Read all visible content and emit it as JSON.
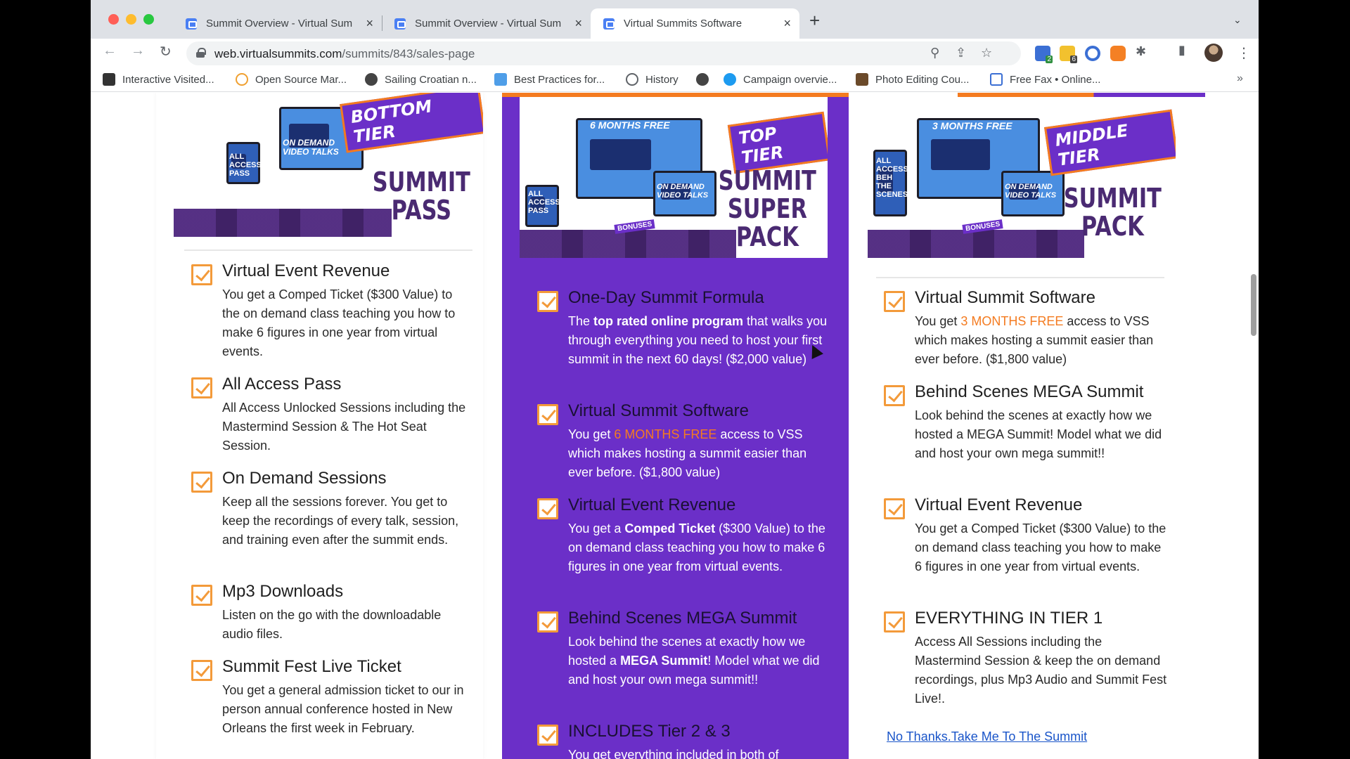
{
  "browser": {
    "tabs": [
      {
        "title": "Summit Overview - Virtual Sum",
        "close": "×"
      },
      {
        "title": "Summit Overview - Virtual Sum",
        "close": "×"
      },
      {
        "title": "Virtual Summits Software",
        "close": "×"
      }
    ],
    "new_tab": "+",
    "tab_search": "⌄",
    "url_host": "web.virtualsummits.com",
    "url_path": "/summits/843/sales-page",
    "bookmarks": [
      "Interactive Visited...",
      "Open Source Mar...",
      "Sailing Croatian n...",
      "Best Practices for...",
      "History",
      "",
      "Campaign overvie...",
      "Photo Editing Cou...",
      "Free Fax • Online..."
    ],
    "bookmarks_more": "»",
    "ext_badges": [
      "2",
      "6"
    ],
    "icons": {
      "back": "←",
      "forward": "→",
      "reload": "↻",
      "zoom": "⚲",
      "share": "⇪",
      "star": "☆",
      "puzzle": "✱",
      "sidepanel": "▮",
      "menu": "⋮"
    }
  },
  "tiers": {
    "left": {
      "badge": "BOTTOM TIER",
      "title_lines": [
        "SUMMIT",
        "PASS"
      ],
      "promo_text": [
        "ALL ACCESS PASS",
        "ON DEMAND VIDEO TALKS"
      ],
      "features": [
        {
          "title": "Virtual Event Revenue",
          "desc": "You get a Comped Ticket ($300 Value) to the on demand class teaching you how to make 6 figures in one year from virtual events."
        },
        {
          "title": "All Access Pass",
          "desc": "All Access Unlocked Sessions including the Mastermind Session & The Hot Seat Session."
        },
        {
          "title": "On Demand Sessions",
          "desc": "Keep all the sessions forever. You get to keep the recordings of every talk, session, and training even after the summit ends."
        },
        {
          "title": "Mp3 Downloads",
          "desc": "Listen on the go with the downloadable audio files."
        },
        {
          "title": "Summit Fest Live Ticket",
          "desc": "You get a general admission ticket to our in person annual conference hosted in New Orleans the first week in February."
        }
      ]
    },
    "middle": {
      "badge": "TOP TIER",
      "title_lines": [
        "SUMMIT",
        "SUPER",
        "PACK"
      ],
      "promo_text": [
        "6 MONTHS FREE",
        "ALL ACCESS PASS",
        "ON DEMAND VIDEO TALKS",
        "BONUSES"
      ],
      "features": [
        {
          "title": "One-Day Summit Formula",
          "desc_parts": [
            "The ",
            "top rated online program",
            " that walks you through everything you need to host your first summit in the next 60 days! ($2,000 value)"
          ]
        },
        {
          "title": "Virtual Summit Software",
          "desc_parts": [
            "You get ",
            "6 MONTHS FREE",
            " access to VSS which makes hosting a summit easier than ever before. ($1,800 value)"
          ]
        },
        {
          "title": "Virtual Event Revenue",
          "desc_parts": [
            "You get a ",
            "Comped Ticket",
            " ($300 Value) to the on demand class teaching you how to make 6 figures in one year from virtual events."
          ]
        },
        {
          "title": "Behind Scenes MEGA Summit",
          "desc_parts": [
            "Look behind the scenes at exactly how we hosted a ",
            "MEGA Summit",
            "! Model what we did and host your own mega summit!!"
          ]
        },
        {
          "title": "INCLUDES Tier 2 & 3",
          "desc_parts": [
            "You get everything included in both of",
            "",
            ""
          ]
        }
      ]
    },
    "right": {
      "badge": "MIDDLE TIER",
      "title_lines": [
        "SUMMIT",
        "PACK"
      ],
      "promo_text": [
        "3 MONTHS FREE",
        "ALL ACCESS BEH THE SCENES",
        "ON DEMAND VIDEO TALKS",
        "BONUSES"
      ],
      "features": [
        {
          "title": "Virtual Summit Software",
          "desc_parts": [
            "You get ",
            "3 MONTHS FREE",
            " access to VSS which makes hosting a summit easier than ever before. ($1,800 value)"
          ]
        },
        {
          "title": "Behind Scenes MEGA Summit",
          "desc_parts": [
            "Look behind the scenes at exactly how we hosted a MEGA Summit! Model what we did and host your own mega summit!!",
            "",
            ""
          ]
        },
        {
          "title": "Virtual Event Revenue",
          "desc_parts": [
            "You get a Comped Ticket ($300 Value) to the on demand class teaching you how to make 6 figures in one year from virtual events.",
            "",
            ""
          ]
        },
        {
          "title": "EVERYTHING IN TIER 1",
          "desc_parts": [
            "Access All Sessions including the Mastermind Session & keep the on demand recordings, plus Mp3 Audio and Summit Fest Live!.",
            "",
            ""
          ]
        }
      ],
      "no_thanks": "No Thanks.Take Me To The Summit"
    }
  },
  "colors": {
    "purple": "#6b2fc8",
    "orange": "#f47b20",
    "link": "#1a55c9"
  }
}
